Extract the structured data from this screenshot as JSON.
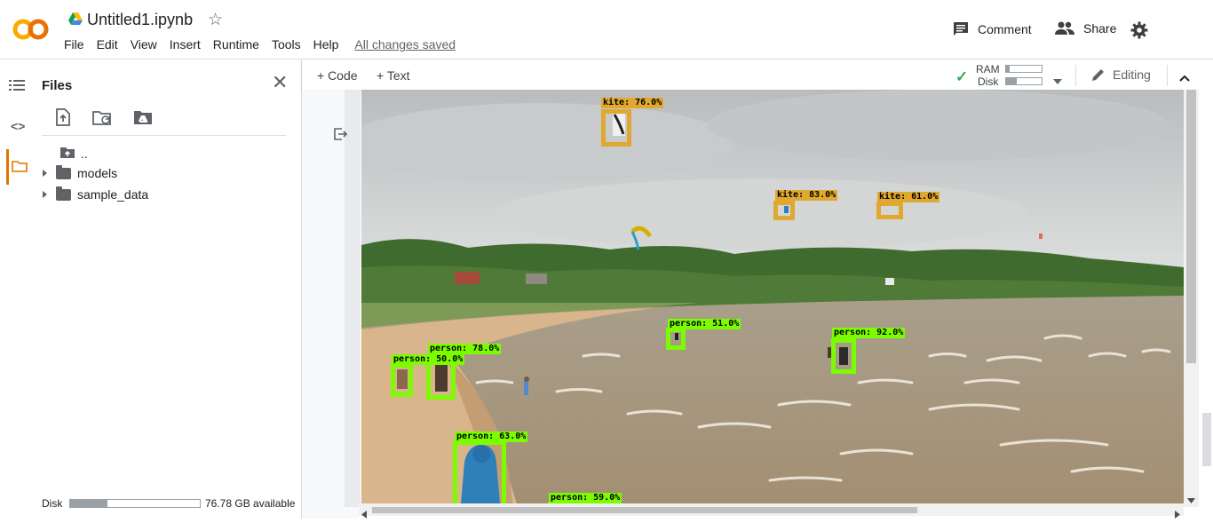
{
  "app": {
    "notebook_title": "Untitled1.ipynb",
    "logo_text": "CO",
    "menus": [
      "File",
      "Edit",
      "View",
      "Insert",
      "Runtime",
      "Tools",
      "Help"
    ],
    "save_status": "All changes saved"
  },
  "header_actions": {
    "comment": "Comment",
    "share": "Share"
  },
  "files_panel": {
    "title": "Files",
    "tree": [
      {
        "label": ".."
      },
      {
        "label": "models"
      },
      {
        "label": "sample_data"
      }
    ],
    "disk_label": "Disk",
    "disk_available": "76.78 GB available",
    "disk_used_fraction": 0.29
  },
  "toolbar": {
    "code_button": "+ Code",
    "text_button": "+ Text",
    "ram_label": "RAM",
    "disk_label": "Disk",
    "ram_used_fraction": 0.1,
    "disk_used_fraction": 0.3,
    "editing_label": "Editing"
  },
  "detections": [
    {
      "label": "kite: 76.0%",
      "color": "#e0a82e"
    },
    {
      "label": "kite: 83.0%",
      "color": "#e0a82e"
    },
    {
      "label": "kite: 61.0%",
      "color": "#e0a82e"
    },
    {
      "label": "person: 51.0%",
      "color": "#7cfc00"
    },
    {
      "label": "person: 92.0%",
      "color": "#7cfc00"
    },
    {
      "label": "person: 78.0%",
      "color": "#7cfc00"
    },
    {
      "label": "person: 50.0%",
      "color": "#7cfc00"
    },
    {
      "label": "person: 63.0%",
      "color": "#7cfc00"
    },
    {
      "label": "person: 59.0%",
      "color": "#7cfc00"
    }
  ],
  "colors": {
    "accent": "#e37400",
    "logo_orange": "#f9ab00",
    "ok_green": "#34a853"
  }
}
